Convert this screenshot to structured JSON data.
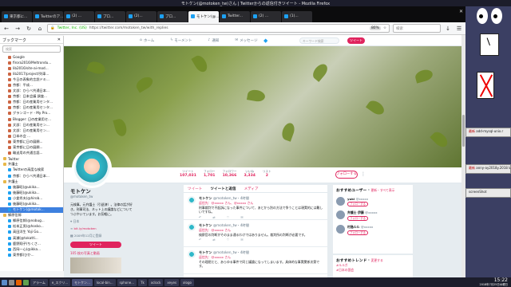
{
  "window": {
    "title": "モトケン(@motoken_tw)さん | Twitterからの返信付きツイート - Mozilla Firefox"
  },
  "tabs": [
    {
      "label": "東京都に...",
      "active": false
    },
    {
      "label": "Twitterのア...",
      "active": false
    },
    {
      "label": "(2) ...",
      "active": false
    },
    {
      "label": "プロ...",
      "active": false
    },
    {
      "label": "(2)...",
      "active": false
    },
    {
      "label": "プロ...",
      "active": false
    },
    {
      "label": "モトケン(@...",
      "active": true
    },
    {
      "label": "Twitter...",
      "active": false
    },
    {
      "label": "(2) ...",
      "active": false
    },
    {
      "label": "(1)...",
      "active": false
    }
  ],
  "navbar": {
    "identity": "Twitter, Inc. (US)",
    "url": "https://twitter.com/motoken_tw/with_replies",
    "zoom": "80%",
    "search_placeholder": "検索"
  },
  "sidebar": {
    "title": "ブックマーク",
    "search_placeholder": "検索",
    "items": [
      {
        "label": "Google",
        "kind": "page",
        "selected": false
      },
      {
        "label": "firora2016/Meltrondu...",
        "kind": "page",
        "selected": false
      },
      {
        "label": "lib2016/site-ai-mod...",
        "kind": "page",
        "selected": false
      },
      {
        "label": "lib2017/project/列車...",
        "kind": "page",
        "selected": false
      },
      {
        "label": "今日の表象的言説ドキ...",
        "kind": "page",
        "selected": false
      },
      {
        "label": "京都：平成...",
        "kind": "page",
        "selected": false
      },
      {
        "label": "文部：ひらべ共通日本...",
        "kind": "page",
        "selected": false
      },
      {
        "label": "京都：日本会議 調査...",
        "kind": "page",
        "selected": false
      },
      {
        "label": "京都：日の産業用センタ...",
        "kind": "page",
        "selected": false
      },
      {
        "label": "京都：日の産業用センタ...",
        "kind": "page",
        "selected": false
      },
      {
        "label": "グランゴード - My Pro...",
        "kind": "page",
        "selected": false
      },
      {
        "label": "Blogger: 日の産業用セ...",
        "kind": "page",
        "selected": false
      },
      {
        "label": "文部：日の産業用セン...",
        "kind": "page",
        "selected": false
      },
      {
        "label": "文部：日の産業用セン...",
        "kind": "page",
        "selected": false
      },
      {
        "label": "日本の会 ...",
        "kind": "page",
        "selected": false
      },
      {
        "label": "東京都に日の展開...",
        "kind": "page",
        "selected": false
      },
      {
        "label": "東京都に日の展開...",
        "kind": "page",
        "selected": false
      },
      {
        "label": "輸送用の共通言語...",
        "kind": "page",
        "selected": false
      },
      {
        "label": "Twitter",
        "kind": "folder",
        "selected": false
      },
      {
        "label": "弁護士",
        "kind": "folder",
        "selected": false
      },
      {
        "label": "Twitterの高度な検索",
        "kind": "tw",
        "selected": false
      },
      {
        "label": "京都：ひらべ共通日本...",
        "kind": "tw",
        "selected": false
      },
      {
        "label": "弁護士",
        "kind": "folder",
        "selected": false
      },
      {
        "label": "後藤昭(@ukika...",
        "kind": "tw",
        "selected": false
      },
      {
        "label": "後藤昭(@ukika...",
        "kind": "tw",
        "selected": false
      },
      {
        "label": "小倉秀夫(@hirob...",
        "kind": "tw",
        "selected": false
      },
      {
        "label": "後藤昭(@ukika...",
        "kind": "tw",
        "selected": false
      },
      {
        "label": "モトケン(@motok...",
        "kind": "tw",
        "selected": true
      },
      {
        "label": "郷原信郎",
        "kind": "folder",
        "selected": false
      },
      {
        "label": "郷原信郎(@nobug...",
        "kind": "tw",
        "selected": false
      },
      {
        "label": "松本正男(@hosko...",
        "kind": "tw",
        "selected": false
      },
      {
        "label": "高田洋生 Yoji Go...",
        "kind": "tw",
        "selected": false
      },
      {
        "label": "高瀬(@tokatti...",
        "kind": "tw",
        "selected": false
      },
      {
        "label": "鹿野翔子(ちくさ...",
        "kind": "tw",
        "selected": false
      },
      {
        "label": "西岡一心(@ikka...",
        "kind": "tw",
        "selected": false
      },
      {
        "label": "東京都(ひか...",
        "kind": "tw",
        "selected": false
      }
    ]
  },
  "twitter": {
    "nav": [
      {
        "label": "ホーム",
        "icon": "home-icon"
      },
      {
        "label": "モーメント",
        "icon": "lightning-icon"
      },
      {
        "label": "通知",
        "icon": "bell-icon"
      },
      {
        "label": "メッセージ",
        "icon": "envelope-icon"
      }
    ],
    "search_placeholder": "キーワード検索",
    "tweet_button": "ツイート",
    "stats": [
      {
        "label": "ツイート",
        "value": "107,031"
      },
      {
        "label": "フォロー",
        "value": "1,701"
      },
      {
        "label": "フォロワー",
        "value": "10,366"
      },
      {
        "label": "いいね",
        "value": "3,334"
      },
      {
        "label": "リスト",
        "value": "2"
      }
    ],
    "follow_button": "フォローする",
    "profile": {
      "name": "モトケン",
      "handle": "@motoken_tw",
      "bio": "元検事。元弁護士（引退済）。法律の話が好き。刑事司法、ネット上の議論などについてつぶやいています。お気軽に。",
      "location": "日本",
      "link": "bit.ly/motoken",
      "joined": "2009年12月に登録",
      "tweet_button": "ツイート",
      "media_label": "105 枚の写真と動画"
    },
    "timeline_tabs": [
      {
        "label": "ツイート",
        "on": false
      },
      {
        "label": "ツイートと返信",
        "on": true
      },
      {
        "label": "メディア",
        "on": false
      }
    ],
    "tweets": [
      {
        "name": "モトケン",
        "handle": "@motoken_tw・4時間",
        "reply_to": "返信先：@xxxxx さん、@xxxxx さん",
        "text": "刑事裁判で不起訴になった事件について、あとから別の方法で争うことは現実的には難しいですね。"
      },
      {
        "name": "モトケン",
        "handle": "@motoken_tw・4時間",
        "reply_to": "返信先：@xxxxx さん",
        "text": "検察官の判断がそのまま通るわけではありません。裁判所の判断が必要です。"
      },
      {
        "name": "モトケン",
        "handle": "@motoken_tw・4時間",
        "reply_to": "返信先：@xxxxx さん",
        "text": "その理屈だと、あらゆる事件で同じ議論になってしまいます。具体的な事実関係次第です。"
      }
    ],
    "who_to_follow": {
      "title": "おすすめユーザー",
      "links": "更新・すべて表示",
      "follow_label": "フォローする",
      "users": [
        {
          "name": "yuki",
          "handle": "@xxxxx"
        },
        {
          "name": "弁護士 伊藤",
          "handle": "@xxxxx"
        },
        {
          "name": "村島ルル",
          "handle": "@xxxxx"
        }
      ]
    },
    "trends": {
      "title": "おすすめトレンド",
      "link": "変更する",
      "items": [
        "#ルルガ",
        "#日本の国会",
        "#トレンド"
      ]
    }
  },
  "desktop": {
    "notes": [
      {
        "title": "最新",
        "text": "add-mysql-unix.r"
      },
      {
        "title": "最新",
        "text": "anny-ay2018y.2018.V"
      },
      {
        "title": "",
        "text": "screenShot"
      }
    ]
  },
  "taskbar": {
    "tasks": [
      {
        "label": "アラーム",
        "active": false
      },
      {
        "label": "e_スクリ...",
        "active": false
      },
      {
        "label": "モトケン...",
        "active": true
      },
      {
        "label": "local-bin...",
        "active": false
      },
      {
        "label": "sphone...",
        "active": false
      },
      {
        "label": "Tk",
        "active": false
      },
      {
        "label": "xclock",
        "active": false
      },
      {
        "label": "xeyes",
        "active": false
      },
      {
        "label": "xlogo",
        "active": false
      }
    ],
    "time": "15:22",
    "date": "2018年7月25日水曜日"
  }
}
